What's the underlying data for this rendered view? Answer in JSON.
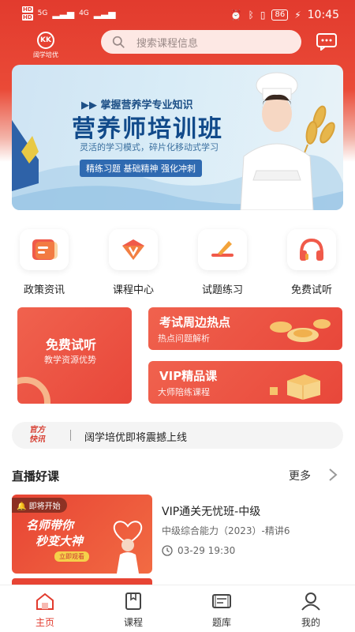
{
  "status": {
    "sim1": "HD",
    "sim2": "HD",
    "signal1": "5G",
    "signal2": "4G",
    "battery": "86",
    "time": "10:45"
  },
  "header": {
    "logo_mark": "KK",
    "logo_text": "阔学培优",
    "search_placeholder": "搜索课程信息"
  },
  "banner": {
    "subtitle": "▶▶ 掌握营养学专业知识",
    "title": "营养师培训班",
    "desc": "灵活的学习模式，碎片化移动式学习",
    "tag": "精练习题 基础精神 强化冲刺"
  },
  "categories": [
    {
      "label": "政策资讯",
      "icon": "news-icon"
    },
    {
      "label": "课程中心",
      "icon": "course-center-icon"
    },
    {
      "label": "试题练习",
      "icon": "exercise-icon"
    },
    {
      "label": "免费试听",
      "icon": "headphones-icon"
    }
  ],
  "promos": {
    "big": {
      "title": "免费试听",
      "sub": "教学资源优势"
    },
    "hot": {
      "title": "考试周边热点",
      "sub": "热点问题解析"
    },
    "vip": {
      "title": "VIP精品课",
      "sub": "大师陪练课程"
    }
  },
  "notice": {
    "tag": "官方快讯",
    "text": "阔学培优即将震撼上线"
  },
  "live": {
    "title": "直播好课",
    "more": "更多",
    "course": {
      "badge": "即将开始",
      "thumb_line1": "名师带你",
      "thumb_line2": "秒变大神",
      "thumb_button": "立即观看",
      "title": "VIP通关无忧班-中级",
      "sub": "中级综合能力（2023）-精讲6",
      "time": "03-29 19:30"
    }
  },
  "tabs": [
    {
      "label": "主页",
      "active": true
    },
    {
      "label": "课程",
      "active": false
    },
    {
      "label": "题库",
      "active": false
    },
    {
      "label": "我的",
      "active": false
    }
  ],
  "colors": {
    "brand_red": "#e23b2e",
    "banner_blue": "#114a8a"
  }
}
